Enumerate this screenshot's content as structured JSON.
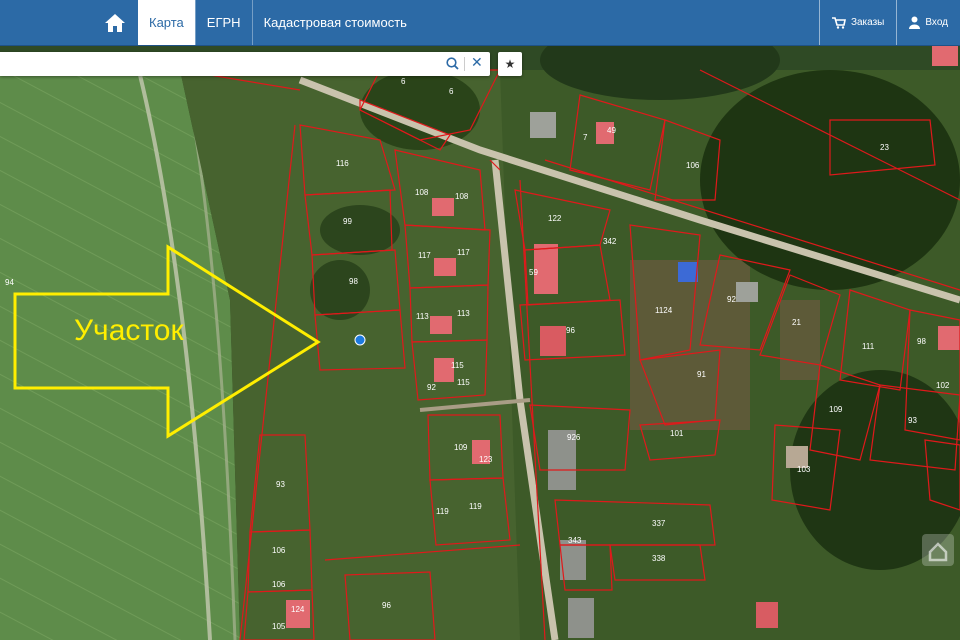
{
  "nav": {
    "home_icon": "home-icon",
    "tabs": [
      {
        "label": "Карта",
        "active": true
      },
      {
        "label": "ЕГРН",
        "active": false
      },
      {
        "label": "Кадастровая стоимость",
        "active": false
      }
    ],
    "orders_label": "Заказы",
    "orders_icon": "cart-icon",
    "login_label": "Вход",
    "login_icon": "user-icon"
  },
  "search": {
    "value": "",
    "placeholder": ""
  },
  "annotation": {
    "text": "Участок",
    "color": "#ffee00"
  },
  "parcel_color": "#e0191b",
  "parcel_labels": [
    "6",
    "6",
    "7",
    "49",
    "106",
    "23",
    "116",
    "108",
    "108",
    "99",
    "122",
    "342",
    "117",
    "117",
    "59",
    "94",
    "98",
    "92",
    "113",
    "113",
    "96",
    "1124",
    "21",
    "111",
    "98",
    "92",
    "115",
    "115",
    "91",
    "109",
    "102",
    "93",
    "101",
    "926",
    "103",
    "93",
    "109",
    "123",
    "119",
    "119",
    "337",
    "343",
    "338",
    "106",
    "106",
    "105",
    "124",
    "96"
  ]
}
